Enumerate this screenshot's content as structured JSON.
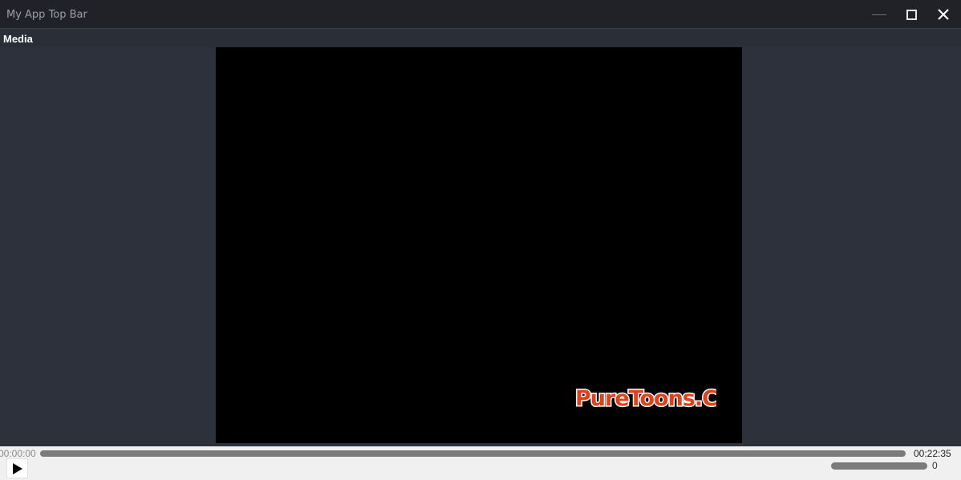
{
  "window": {
    "title": "My App Top Bar",
    "buttons": {
      "minimize": "minimize-icon",
      "maximize": "maximize-icon",
      "close": "close-icon"
    }
  },
  "menu": {
    "items": [
      {
        "label": "Media"
      }
    ]
  },
  "video": {
    "background": "#000000",
    "watermark_text": "PureToons.Com"
  },
  "player": {
    "current_time": "00:00:00",
    "total_time": "00:22:35",
    "seek_progress": 0,
    "play_icon": "play-icon",
    "volume_value": "0"
  },
  "colors": {
    "titlebar": "#202227",
    "background": "#2d313b",
    "controls_bg": "#f0f0f0",
    "slider": "#7b7b7b",
    "watermark_fill": "#e0401a"
  }
}
